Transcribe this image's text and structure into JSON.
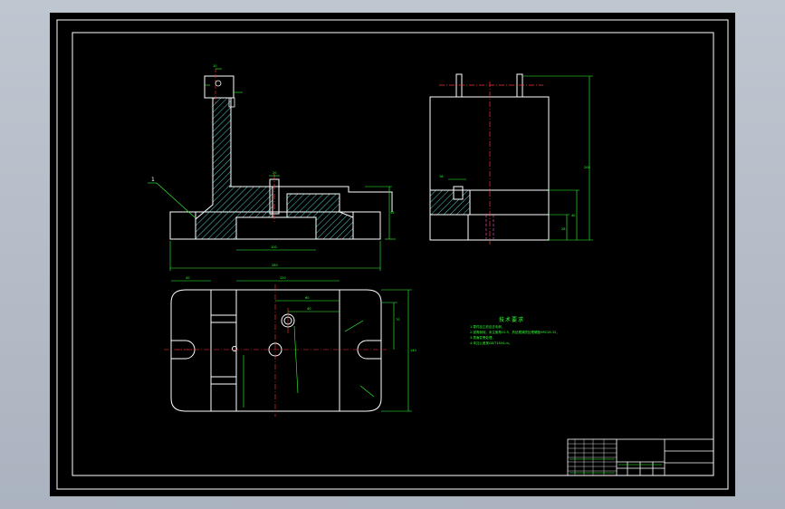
{
  "drawing": {
    "part_callout": "1",
    "colors": {
      "background": "#000000",
      "frame": "#ffffff",
      "outline": "#ffffff",
      "dimension": "#33ff33",
      "centerline": "#ff3333",
      "hatch": "#66ffff",
      "hidden": "#ff66cc"
    }
  },
  "technical_requirements": {
    "title": "技术要求",
    "lines": [
      "1.零件加工前应去毛刺，",
      "2.锐角倒钝，未注倒角C0.5，热处理调质处理硬度HRC28-32，",
      "3.表面发黑处理，",
      "4.未注公差按GB/T1804-m。"
    ]
  },
  "icons": [
    "circle-hole-icon",
    "slot-icon"
  ]
}
